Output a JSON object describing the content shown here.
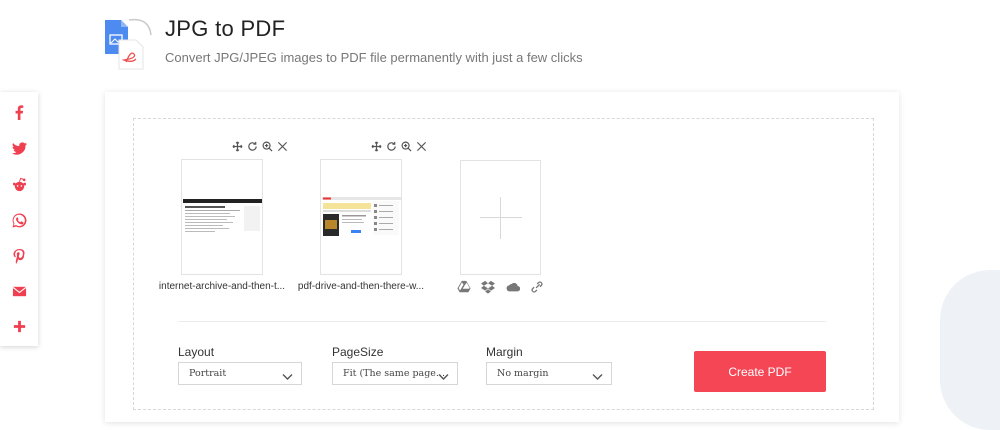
{
  "header": {
    "title": "JPG to PDF",
    "subtitle": "Convert JPG/JPEG images to PDF file permanently with just a few clicks",
    "icon": "jpg-to-pdf-icon"
  },
  "share": {
    "items": [
      {
        "name": "facebook-icon"
      },
      {
        "name": "twitter-icon"
      },
      {
        "name": "reddit-icon"
      },
      {
        "name": "whatsapp-icon"
      },
      {
        "name": "pinterest-icon"
      },
      {
        "name": "email-icon"
      },
      {
        "name": "more-share-icon"
      }
    ]
  },
  "files": [
    {
      "name": "internet-archive-and-then-t...",
      "tools": [
        "move-icon",
        "rotate-icon",
        "zoom-icon",
        "remove-icon"
      ]
    },
    {
      "name": "pdf-drive-and-then-there-w...",
      "tools": [
        "move-icon",
        "rotate-icon",
        "zoom-icon",
        "remove-icon"
      ]
    }
  ],
  "upload_sources": [
    "google-drive-icon",
    "dropbox-icon",
    "onedrive-icon",
    "url-link-icon"
  ],
  "options": {
    "layout": {
      "label": "Layout",
      "value": "Portrait"
    },
    "page_size": {
      "label": "PageSize",
      "value": "Fit (The same page..."
    },
    "margin": {
      "label": "Margin",
      "value": "No margin"
    }
  },
  "create_button": "Create PDF",
  "colors": {
    "accent": "#f54656",
    "share_icon": "#f03f4f"
  }
}
